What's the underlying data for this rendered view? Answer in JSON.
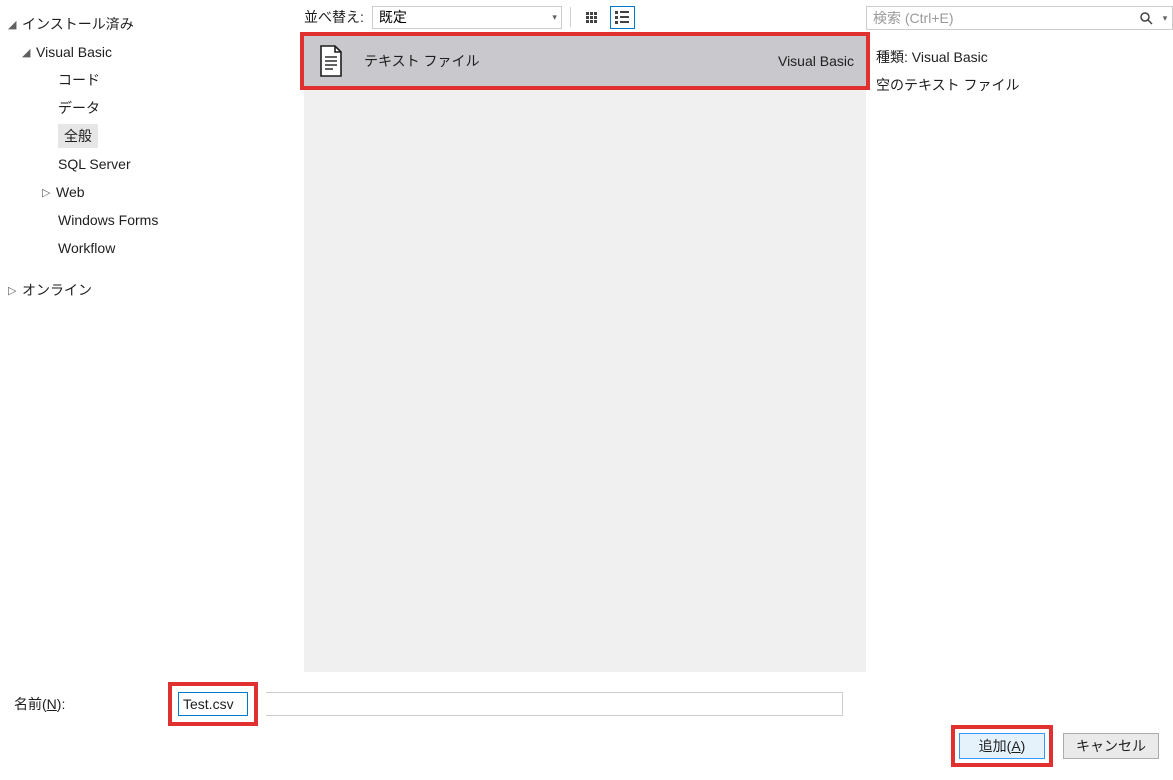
{
  "sidebar": {
    "installed": "インストール済み",
    "vb": "Visual Basic",
    "items": [
      "コード",
      "データ",
      "全般",
      "SQL Server",
      "Web",
      "Windows Forms",
      "Workflow"
    ],
    "online": "オンライン"
  },
  "toolbar": {
    "sort_label": "並べ替え:",
    "sort_value": "既定"
  },
  "template": {
    "name": "テキスト ファイル",
    "language": "Visual Basic"
  },
  "search": {
    "placeholder": "検索 (Ctrl+E)"
  },
  "details": {
    "type_label": "種類:",
    "type_value": "Visual Basic",
    "description": "空のテキスト ファイル"
  },
  "bottom": {
    "name_label_prefix": "名前(",
    "name_label_key": "N",
    "name_label_suffix": "):",
    "name_value": "Test.csv",
    "add_prefix": "追加(",
    "add_key": "A",
    "add_suffix": ")",
    "cancel": "キャンセル"
  }
}
